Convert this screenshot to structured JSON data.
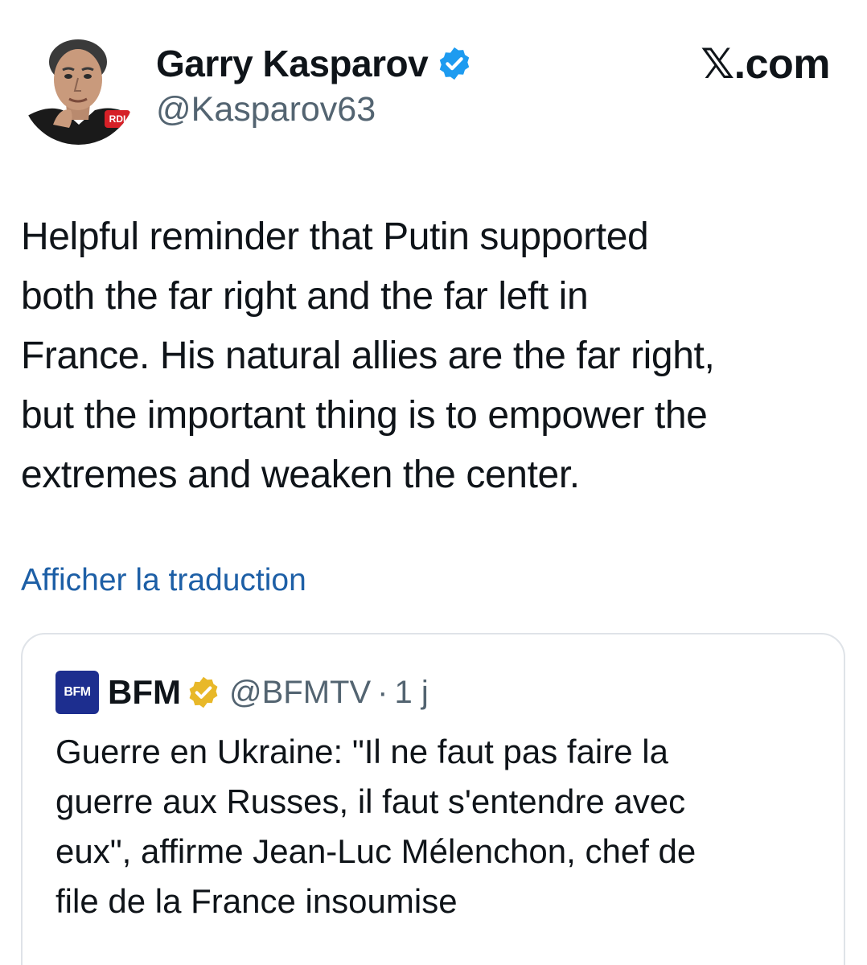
{
  "author": {
    "name": "Garry Kasparov",
    "handle": "@Kasparov63",
    "avatar_badge": "RDI",
    "verified_color": "#1d9bf0"
  },
  "site_label": "𝕏.com",
  "tweet_lines": [
    "Helpful reminder that Putin supported",
    "both the far right and the far left in",
    "France. His natural allies are the far right,",
    "but the important thing is to empower the",
    "extremes and weaken the center."
  ],
  "translate_link": "Afficher la traduction",
  "quoted_tweet": {
    "logo_text": "BFM",
    "name": "BFM",
    "handle": "@BFMTV",
    "separator": "·",
    "time": "1 j",
    "badge_color": "#e8b829",
    "lines": [
      "Guerre en Ukraine: \"Il ne faut pas faire la",
      "guerre aux Russes, il faut s'entendre avec",
      "eux\", affirme Jean-Luc Mélenchon, chef de",
      "file de la France insoumise"
    ]
  },
  "colors": {
    "link": "#1d5fa6",
    "secondary_text": "#536471",
    "card_border": "#dfe3e8"
  }
}
